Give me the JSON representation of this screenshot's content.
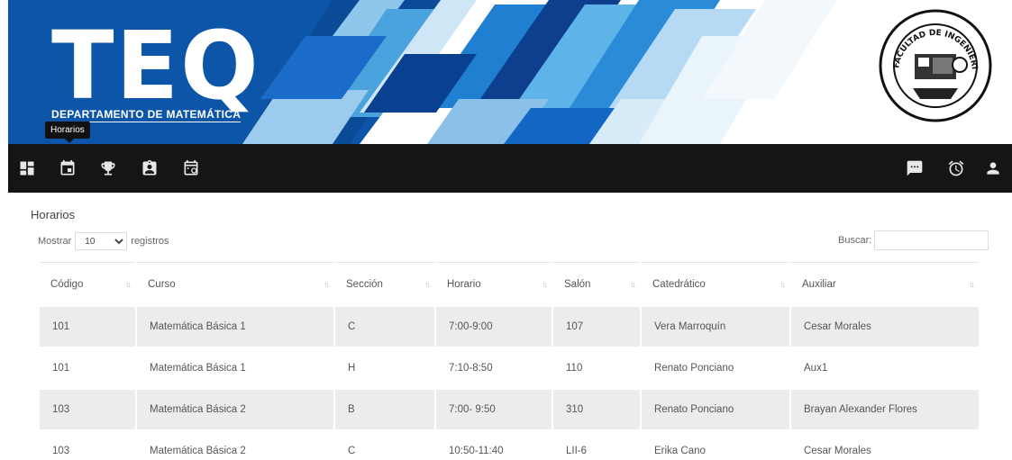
{
  "header": {
    "logo_text": "TEQ",
    "logo_subtitle": "DEPARTAMENTO DE MATEMÁTICA",
    "seal_text": "FACULTAD DE INGENIERIA USAC"
  },
  "tooltip": "Horarios",
  "navbar": {
    "left_icons": [
      "dashboard-icon",
      "calendar-icon",
      "trophy-icon",
      "assignment-ind-icon",
      "schedule-calendar-icon"
    ],
    "right_icons": [
      "chat-icon",
      "alarm-icon",
      "person-icon"
    ]
  },
  "page": {
    "title": "Horarios",
    "length_label_before": "Mostrar",
    "length_value": "10",
    "length_label_after": "registros",
    "search_label": "Buscar:"
  },
  "table": {
    "headers": [
      "Código",
      "Curso",
      "Sección",
      "Horario",
      "Salón",
      "Catedrático",
      "Auxiliar"
    ],
    "rows": [
      [
        "101",
        "Matemática Básica 1",
        "C",
        "7:00-9:00",
        "107",
        "Vera Marroquín",
        "Cesar Morales"
      ],
      [
        "101",
        "Matemática Básica 1",
        "H",
        "7:10-8:50",
        "110",
        "Renato Ponciano",
        "Aux1"
      ],
      [
        "103",
        "Matemática Básica 2",
        "B",
        "7:00- 9:50",
        "310",
        "Renato Ponciano",
        "Brayan Alexander Flores"
      ],
      [
        "103",
        "Matemática Básica 2",
        "C",
        "10:50-11:40",
        "LII-6",
        "Erika Cano",
        "Cesar Morales"
      ]
    ]
  },
  "colors": {
    "banner_blue": "#0d55a8",
    "navbar_bg": "#151515",
    "row_stripe": "#ececec"
  }
}
